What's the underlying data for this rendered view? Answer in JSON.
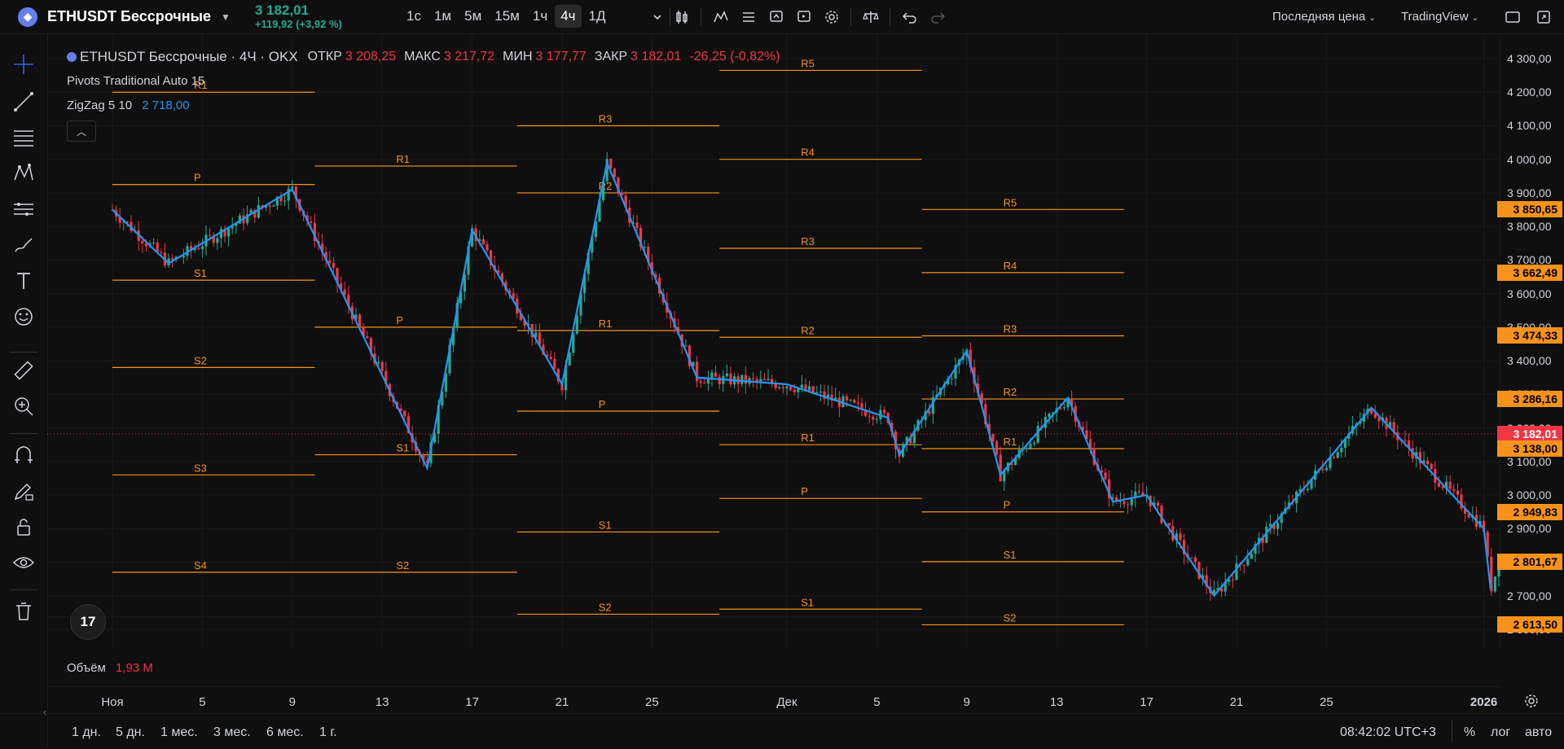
{
  "symbol": {
    "name": "ETHUSDT Бессрочные",
    "price": "3 182,01",
    "change": "+119,92 (+3,92 %)",
    "logo": "ethereum-icon"
  },
  "intervals": [
    {
      "label": "1с",
      "active": false
    },
    {
      "label": "1м",
      "active": false
    },
    {
      "label": "5м",
      "active": false
    },
    {
      "label": "15м",
      "active": false
    },
    {
      "label": "1ч",
      "active": false
    },
    {
      "label": "4ч",
      "active": true
    },
    {
      "label": "1Д",
      "active": false
    }
  ],
  "topbar_right": {
    "price_type": "Последняя цена",
    "brand": "TradingView"
  },
  "legend": {
    "title": "ETHUSDT Бессрочные · 4Ч · OKX",
    "open_label": "ОТКР",
    "open": "3 208,25",
    "high_label": "МАКС",
    "high": "3 217,72",
    "low_label": "МИН",
    "low": "3 177,77",
    "close_label": "ЗАКР",
    "close": "3 182,01",
    "change": "-26,25 (-0,82%)",
    "pivots": "Pivots Traditional Auto 15",
    "zigzag": "ZigZag 5 10",
    "zigzag_value": "2 718,00"
  },
  "volume": {
    "label": "Объём",
    "value": "1,93 M"
  },
  "price_axis": {
    "labels": [
      "4 300,00",
      "4 200,00",
      "4 100,00",
      "4 000,00",
      "3 900,00",
      "3 800,00",
      "3 700,00",
      "3 600,00",
      "3 500,00",
      "3 400,00",
      "3 300,00",
      "3 200,00",
      "3 100,00",
      "3 000,00",
      "2 900,00",
      "2 800,00",
      "2 700,00",
      "2 600,00"
    ],
    "values": [
      4300,
      4200,
      4100,
      4000,
      3900,
      3800,
      3700,
      3600,
      3500,
      3400,
      3300,
      3200,
      3100,
      3000,
      2900,
      2800,
      2700,
      2600
    ],
    "badges": [
      {
        "text": "3 850,65",
        "value": 3850.65,
        "color": "#f7931a"
      },
      {
        "text": "3 662,49",
        "value": 3662.49,
        "color": "#f7931a"
      },
      {
        "text": "3 474,33",
        "value": 3474.33,
        "color": "#f7931a"
      },
      {
        "text": "3 286,16",
        "value": 3286.16,
        "color": "#f7931a"
      },
      {
        "text": "3 182,01",
        "value": 3182.01,
        "color": "#f23645"
      },
      {
        "text": "3 138,00",
        "value": 3138.0,
        "color": "#f7931a"
      },
      {
        "text": "2 949,83",
        "value": 2949.83,
        "color": "#f7931a"
      },
      {
        "text": "2 801,67",
        "value": 2801.67,
        "color": "#f7931a"
      },
      {
        "text": "2 613,50",
        "value": 2613.5,
        "color": "#f7931a"
      }
    ]
  },
  "time_axis": {
    "labels": [
      "Ноя",
      "5",
      "9",
      "13",
      "17",
      "21",
      "25",
      "Дек",
      "5",
      "9",
      "13",
      "17",
      "21",
      "25",
      "2026"
    ],
    "days": [
      0,
      4,
      8,
      12,
      16,
      20,
      24,
      30,
      34,
      38,
      42,
      46,
      50,
      54,
      61
    ]
  },
  "ranges": [
    "1 дн.",
    "5 дн.",
    "1 мес.",
    "3 мес.",
    "6 мес.",
    "1 г."
  ],
  "bottom_right": {
    "clock": "08:42:02 UTC+3",
    "percent": "%",
    "log": "лог",
    "auto": "авто"
  },
  "chart_data": {
    "type": "candlestick",
    "x_unit": "days since Nov 1 (4h candles)",
    "ylim": [
      2600,
      4300
    ],
    "zigzag": [
      [
        0,
        3850
      ],
      [
        2.5,
        3690
      ],
      [
        8,
        3910
      ],
      [
        14,
        3080
      ],
      [
        16,
        3790
      ],
      [
        20,
        3330
      ],
      [
        22,
        3990
      ],
      [
        26,
        3350
      ],
      [
        30,
        3330
      ],
      [
        34.5,
        3230
      ],
      [
        35,
        3120
      ],
      [
        38,
        3430
      ],
      [
        39.5,
        3060
      ],
      [
        42.5,
        3290
      ],
      [
        44.5,
        2980
      ],
      [
        46,
        3000
      ],
      [
        49,
        2700
      ],
      [
        56,
        3260
      ],
      [
        61,
        2900
      ],
      [
        61.3,
        2720
      ]
    ],
    "pivot_periods": [
      {
        "x0": 0,
        "x1": 9,
        "levels": [
          {
            "label": "P",
            "v": 3925
          },
          {
            "label": "S1",
            "v": 3640
          },
          {
            "label": "S2",
            "v": 3380
          },
          {
            "label": "S3",
            "v": 3060
          },
          {
            "label": "S4",
            "v": 2770
          },
          {
            "label": "R1",
            "v": 4200
          }
        ]
      },
      {
        "x0": 9,
        "x1": 18,
        "levels": [
          {
            "label": "R1",
            "v": 3980
          },
          {
            "label": "P",
            "v": 3500
          },
          {
            "label": "S1",
            "v": 3120
          },
          {
            "label": "S2",
            "v": 2770
          }
        ]
      },
      {
        "x0": 18,
        "x1": 27,
        "levels": [
          {
            "label": "R3",
            "v": 4100
          },
          {
            "label": "R2",
            "v": 3900
          },
          {
            "label": "R1",
            "v": 3490
          },
          {
            "label": "P",
            "v": 3250
          },
          {
            "label": "S1",
            "v": 2890
          },
          {
            "label": "S2",
            "v": 2645
          }
        ]
      },
      {
        "x0": 27,
        "x1": 36,
        "levels": [
          {
            "label": "R5",
            "v": 4265
          },
          {
            "label": "R4",
            "v": 4000
          },
          {
            "label": "R3",
            "v": 3735
          },
          {
            "label": "R2",
            "v": 3470
          },
          {
            "label": "R1",
            "v": 3150
          },
          {
            "label": "P",
            "v": 2990
          },
          {
            "label": "S1",
            "v": 2660
          }
        ]
      },
      {
        "x0": 36,
        "x1": 45,
        "levels": [
          {
            "label": "R5",
            "v": 3850.65
          },
          {
            "label": "R4",
            "v": 3662.49
          },
          {
            "label": "R3",
            "v": 3474.33
          },
          {
            "label": "R2",
            "v": 3286.16
          },
          {
            "label": "R1",
            "v": 3138.0
          },
          {
            "label": "P",
            "v": 2949.83
          },
          {
            "label": "S1",
            "v": 2801.67
          },
          {
            "label": "S2",
            "v": 2613.5
          }
        ]
      }
    ],
    "last_price": 3182.01
  }
}
